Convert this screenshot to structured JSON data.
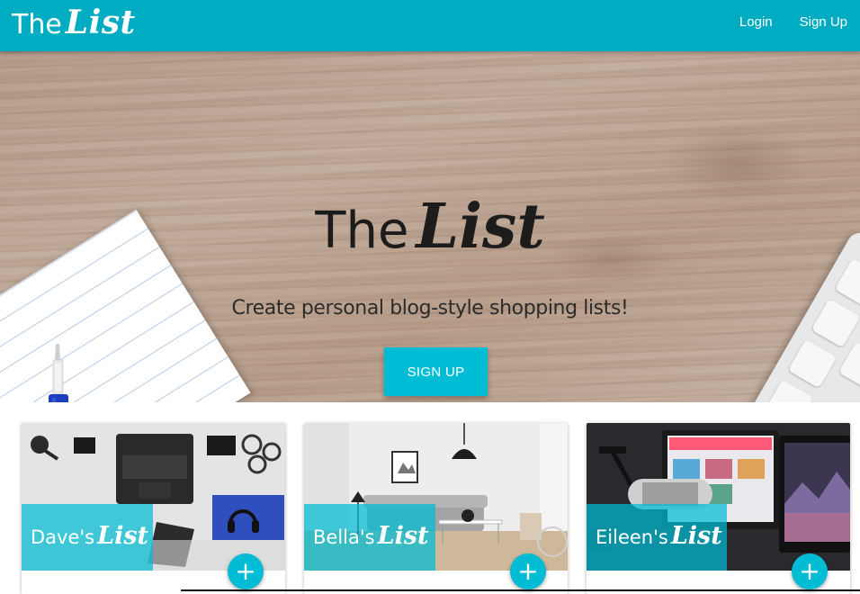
{
  "navbar": {
    "brand_the": "The",
    "brand_list": "List",
    "login_label": "Login",
    "signup_label": "Sign Up"
  },
  "hero": {
    "title_the": "The",
    "title_list": "List",
    "subtitle": "Create personal blog-style shopping lists!",
    "button_label": "SIGN UP"
  },
  "cards": [
    {
      "name": "Dave's",
      "list_word": "List",
      "add_label": "+"
    },
    {
      "name": "Bella's",
      "list_word": "List",
      "add_label": "+"
    },
    {
      "name": "Eileen's",
      "list_word": "List",
      "add_label": "+"
    }
  ],
  "colors": {
    "primary": "#00acc1",
    "accent": "#00bcd4"
  }
}
